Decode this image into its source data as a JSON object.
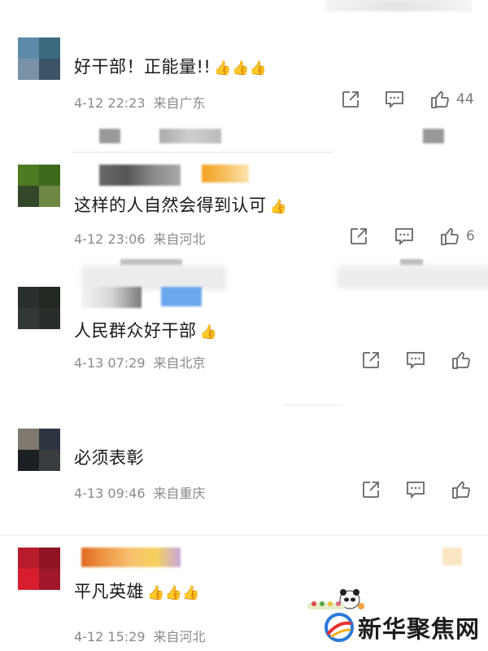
{
  "comments": [
    {
      "text": "好干部！正能量!!",
      "emoji": "👍👍👍",
      "date": "4-12 22:23",
      "location": "来自广东",
      "likes": "44",
      "avatar_colors": [
        "#5d8aa8",
        "#3e6a80",
        "#7a92a6",
        "#3c5466"
      ]
    },
    {
      "text": "这样的人自然会得到认可",
      "emoji": "👍",
      "date": "4-12 23:06",
      "location": "来自河北",
      "likes": "6",
      "avatar_colors": [
        "#4e7a22",
        "#3d6a1b",
        "#35472a",
        "#6e8844"
      ]
    },
    {
      "text": "人民群众好干部",
      "emoji": "👍",
      "date": "4-13 07:29",
      "location": "来自北京",
      "likes": "",
      "avatar_colors": [
        "#2c302c",
        "#222822",
        "#343834",
        "#2a2e2a"
      ]
    },
    {
      "text": "必须表彰",
      "emoji": "",
      "date": "4-13 09:46",
      "location": "来自重庆",
      "likes": "",
      "avatar_colors": [
        "#7f786d",
        "#2e3540",
        "#1c2024",
        "#3a3d40"
      ]
    },
    {
      "text": "平凡英雄",
      "emoji": "👍👍👍",
      "date": "4-12 15:29",
      "location": "来自河北",
      "likes": "",
      "avatar_colors": [
        "#b81c2c",
        "#8e1422",
        "#d81e2e",
        "#a0182a"
      ]
    }
  ],
  "watermark": {
    "text": "新华聚焦网"
  },
  "icons": {
    "share": "share-icon",
    "comment": "comment-icon",
    "like": "thumbs-up-icon"
  }
}
